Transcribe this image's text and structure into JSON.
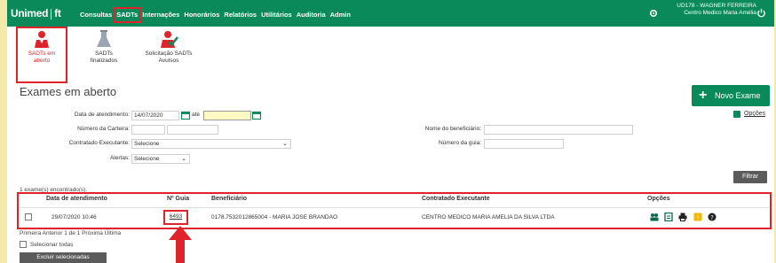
{
  "header": {
    "brand_left": "Unimed",
    "brand_right": "ft",
    "menu": [
      "Consultas",
      "SADTs",
      "Internações",
      "Honorários",
      "Relatórios",
      "Utilitários",
      "Auditoria",
      "Admin"
    ],
    "user_line1": "UD178 - WAGNER FERREIRA",
    "user_line2": "Centro Medico Maria Amélia",
    "icons": [
      "settings-icon",
      "power-icon"
    ],
    "bar_color": "#0a8a5a"
  },
  "tiles": [
    {
      "line1": "SADTs em",
      "line2": "aberto",
      "icon": "doctor-icon"
    },
    {
      "line1": "SADTs",
      "line2": "finalizados",
      "icon": "flask-icon"
    },
    {
      "line1": "Solicitação SADTs",
      "line2": "Avulsos",
      "icon": "doctor-check-icon"
    }
  ],
  "page": {
    "title": "Exames em aberto",
    "new_button": "Novo Exame",
    "options_link": "Opções",
    "filter_button": "Filtrar"
  },
  "filters": {
    "date_label": "Data de atendimento:",
    "date_from": "14/07/2020",
    "ate_label": "até",
    "date_to": "",
    "card_label": "Número da Carteira:",
    "card_value": "",
    "contractor_label": "Contratado Executante:",
    "contractor_value": "Selecione",
    "alerts_label": "Alertas:",
    "alerts_value": "Selecione",
    "beneficiary_label": "Nome do beneficiário:",
    "beneficiary_value": "",
    "guia_label": "Número da guia:",
    "guia_value": ""
  },
  "results": {
    "found_text": "1 exame(s) encontrado(s).",
    "columns": [
      "Data de atendimento",
      "Nº Guia",
      "Beneficiário",
      "Contratado Executante",
      "Opções"
    ],
    "rows": [
      {
        "date": "29/07/2020 10:46",
        "guia": "6493",
        "beneficiary": "0178.7532012865004 - MARIA JOSE BRANDAO",
        "contractor": "CENTRO MEDICO MARIA AMELIA DA SILVA LTDA",
        "actions": [
          "people-icon",
          "document-icon",
          "print-icon",
          "warning-icon",
          "help-icon"
        ]
      }
    ],
    "pager": "Primeira Anterior   1 de 1   Próxima Última",
    "select_all": "Selecionar todas",
    "delete_button": "Excluir selecionadas"
  },
  "colors": {
    "accent": "#0a8a5a",
    "highlight": "#e0232b",
    "background": "#f3e9a8"
  }
}
